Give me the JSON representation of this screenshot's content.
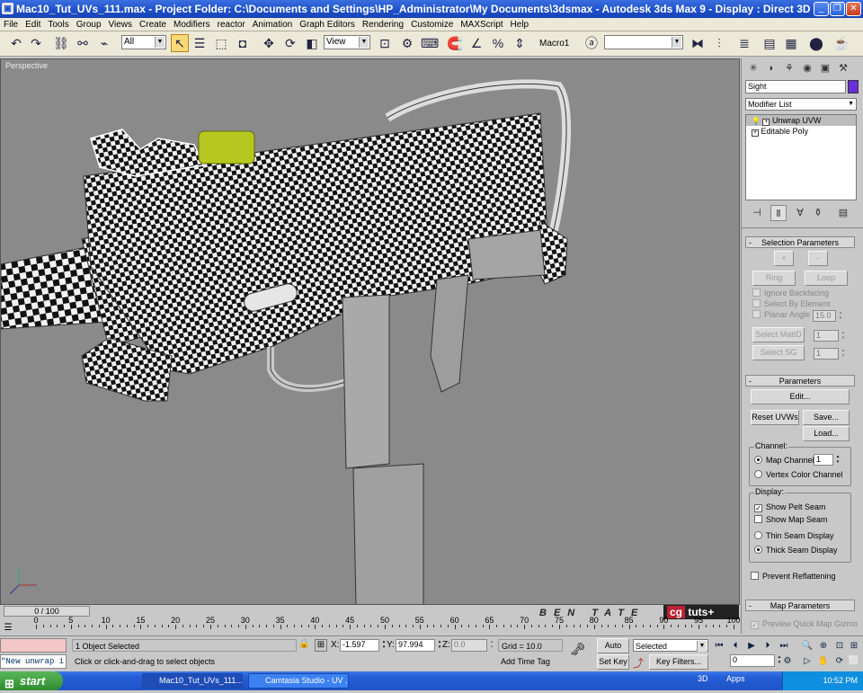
{
  "window": {
    "title": "Mac10_Tut_UVs_111.max     - Project Folder: C:\\Documents and Settings\\HP_Administrator\\My Documents\\3dsmax     - Autodesk 3ds Max 9     - Display : Direct 3D"
  },
  "menu": [
    "File",
    "Edit",
    "Tools",
    "Group",
    "Views",
    "Create",
    "Modifiers",
    "reactor",
    "Animation",
    "Graph Editors",
    "Rendering",
    "Customize",
    "MAXScript",
    "Help"
  ],
  "toolbar": {
    "selection_filter": "All",
    "reference_coord": "View",
    "macro_label": "Macro1",
    "named_selection": ""
  },
  "viewport": {
    "label": "Perspective",
    "watermark_text": "BEN TATE",
    "logo_left": "cg",
    "logo_right": "tuts+"
  },
  "command_panel": {
    "object_name": "Sight",
    "object_color": "#6b2fd8",
    "modifier_list_label": "Modifier List",
    "stack": [
      {
        "label": "Unwrap UVW",
        "selected": true
      },
      {
        "label": "Editable Poly",
        "selected": false
      }
    ],
    "selection_parameters": {
      "title": "Selection Parameters",
      "plus": "+",
      "minus": "-",
      "ring": "Ring",
      "loop": "Loop",
      "ignore_backfacing": "Ignore Backfacing",
      "select_by_element": "Select By Element",
      "planar_angle": "Planar Angle",
      "planar_angle_value": "15.0",
      "select_matid": "Select MatID",
      "matid_value": "1",
      "select_sg": "Select SG",
      "sg_value": "1"
    },
    "parameters": {
      "title": "Parameters",
      "edit": "Edit...",
      "reset_uvws": "Reset UVWs",
      "save": "Save...",
      "load": "Load...",
      "channel_title": "Channel:",
      "map_channel": "Map Channel:",
      "map_channel_value": "1",
      "vertex_color_channel": "Vertex Color Channel",
      "display_title": "Display:",
      "show_pelt_seam": "Show Pelt Seam",
      "show_pelt_seam_checked": true,
      "show_map_seam": "Show Map Seam",
      "show_map_seam_checked": false,
      "thin_seam": "Thin Seam Display",
      "thick_seam": "Thick Seam Display",
      "prevent_reflattening": "Prevent Reflattening"
    },
    "map_parameters": {
      "title": "Map Parameters",
      "preview_gizmo": "Preview Quick Map Gizmo"
    }
  },
  "timeline": {
    "slider_label": "0 / 100",
    "ticks": [
      0,
      5,
      10,
      15,
      20,
      25,
      30,
      35,
      40,
      45,
      50,
      55,
      60,
      65,
      70,
      75,
      80,
      85,
      90,
      95,
      100
    ]
  },
  "status": {
    "maxscript_listener": "\"New unwrap i",
    "selection_info": "1 Object Selected",
    "prompt": "Click or click-and-drag to select objects",
    "x_label": "X:",
    "x_value": "-1.597",
    "y_label": "Y:",
    "y_value": "97.994",
    "z_label": "Z:",
    "z_value": "0.0",
    "grid": "Grid = 10.0",
    "add_time_tag": "Add Time Tag",
    "auto_key": "Auto Key",
    "set_key": "Set Key",
    "key_mode": "Selected",
    "key_filters": "Key Filters...",
    "frame_value": "0"
  },
  "taskbar": {
    "start": "start",
    "tasks": [
      "Mac10_Tut_UVs_111...",
      "Camtasia Studio - UV ..."
    ],
    "tray_items": [
      "3D",
      "Apps"
    ],
    "clock": "10:52 PM"
  }
}
